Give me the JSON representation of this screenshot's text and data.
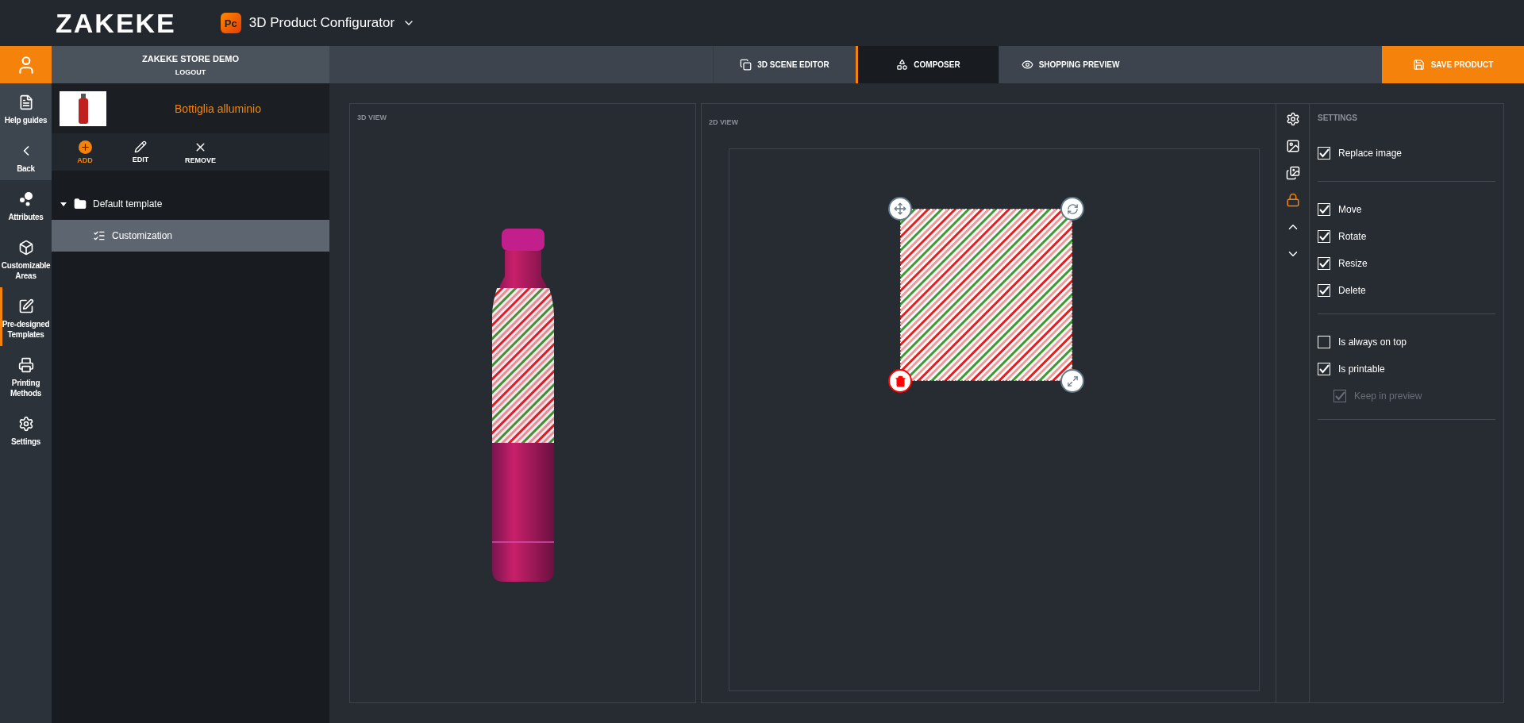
{
  "header": {
    "logo": "ZAKEKE",
    "app_badge": "Pc",
    "app_title": "3D Product Configurator"
  },
  "account": {
    "store": "ZAKEKE STORE DEMO",
    "logout": "LOGOUT"
  },
  "tabs": [
    {
      "label": "3D SCENE EDITOR",
      "selected": false
    },
    {
      "label": "COMPOSER",
      "selected": true
    },
    {
      "label": "SHOPPING PREVIEW",
      "selected": false
    }
  ],
  "save_button": "SAVE PRODUCT",
  "sidebar": [
    {
      "label": "Help guides",
      "kind": "utility",
      "selected": false
    },
    {
      "label": "Back",
      "kind": "utility",
      "selected": false
    },
    {
      "label": "Attributes",
      "kind": "section",
      "selected": false
    },
    {
      "label": "Customizable Areas",
      "kind": "section",
      "selected": false
    },
    {
      "label": "Pre-designed Templates",
      "kind": "section",
      "selected": true
    },
    {
      "label": "Printing Methods",
      "kind": "section",
      "selected": false
    },
    {
      "label": "Settings",
      "kind": "section",
      "selected": false
    }
  ],
  "product": {
    "name": "Bottiglia alluminio"
  },
  "toolbar": [
    {
      "label": "ADD",
      "active": true
    },
    {
      "label": "EDIT",
      "active": false
    },
    {
      "label": "REMOVE",
      "active": false
    }
  ],
  "tree": [
    {
      "label": "Default template",
      "expanded": true,
      "selected": false,
      "children": [
        {
          "label": "Customization",
          "selected": true
        }
      ]
    }
  ],
  "view_3d": {
    "title": "3D VIEW"
  },
  "view_2d": {
    "title": "2D VIEW"
  },
  "tools": [
    {
      "active": false
    },
    {
      "active": false
    },
    {
      "active": false
    },
    {
      "active": true
    },
    {
      "active": false
    },
    {
      "active": false
    }
  ],
  "settings": {
    "title": "SETTINGS",
    "groups": [
      {
        "options": [
          {
            "label": "Replace image",
            "checked": true,
            "disabled": false
          }
        ]
      },
      {
        "options": [
          {
            "label": "Move",
            "checked": true,
            "disabled": false
          },
          {
            "label": "Rotate",
            "checked": true,
            "disabled": false
          },
          {
            "label": "Resize",
            "checked": true,
            "disabled": false
          },
          {
            "label": "Delete",
            "checked": true,
            "disabled": false
          }
        ]
      },
      {
        "options": [
          {
            "label": "Is always on top",
            "checked": false,
            "disabled": false
          },
          {
            "label": "Is printable",
            "checked": true,
            "disabled": false,
            "children": [
              {
                "label": "Keep in preview",
                "checked": true,
                "disabled": true
              }
            ]
          }
        ]
      }
    ]
  }
}
